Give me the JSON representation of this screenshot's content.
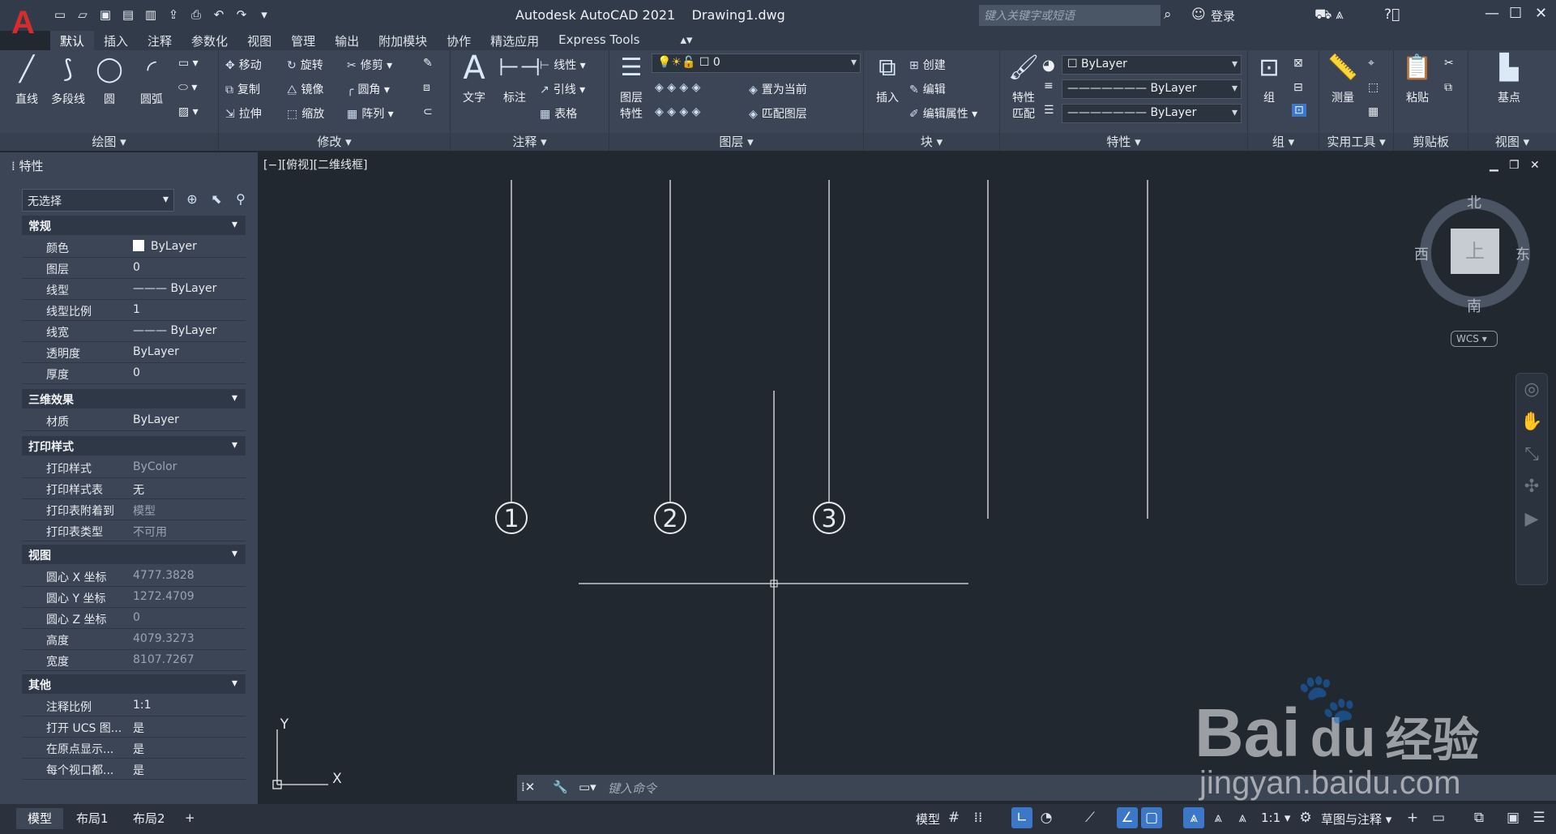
{
  "title": {
    "app": "Autodesk AutoCAD 2021",
    "file": "Drawing1.dwg"
  },
  "logo": "A",
  "search": {
    "placeholder": "键入关键字或短语"
  },
  "login": "登录",
  "tabs": [
    "默认",
    "插入",
    "注释",
    "参数化",
    "视图",
    "管理",
    "输出",
    "附加模块",
    "协作",
    "精选应用",
    "Express Tools"
  ],
  "ribbon": {
    "draw": {
      "title": "绘图",
      "line": "直线",
      "polyline": "多段线",
      "circle": "圆",
      "arc": "圆弧"
    },
    "modify": {
      "title": "修改",
      "move": "移动",
      "rotate": "旋转",
      "trim": "修剪",
      "copy": "复制",
      "mirror": "镜像",
      "fillet": "圆角",
      "stretch": "拉伸",
      "scale": "缩放",
      "array": "阵列"
    },
    "annotation": {
      "title": "注释",
      "text": "文字",
      "dimension": "标注",
      "linear": "线性",
      "leader": "引线",
      "table": "表格"
    },
    "layers": {
      "title": "图层",
      "props": "图层\n特性",
      "layer": "0",
      "set_current": "置为当前",
      "match_layer": "匹配图层"
    },
    "block": {
      "title": "块",
      "insert": "插入",
      "create": "创建",
      "edit": "编辑",
      "edit_attr": "编辑属性"
    },
    "properties": {
      "title": "特性",
      "match": "特性\n匹配",
      "color": "ByLayer",
      "linetype": "ByLayer",
      "lineweight": "ByLayer"
    },
    "groups": {
      "title": "组",
      "group": "组"
    },
    "utilities": {
      "title": "实用工具",
      "measure": "测量"
    },
    "clipboard": {
      "title": "剪贴板",
      "paste": "粘贴"
    },
    "view": {
      "title": "视图",
      "base": "基点"
    }
  },
  "props_panel": {
    "header": "特性",
    "selection": "无选择",
    "sections": [
      {
        "name": "常规",
        "rows": [
          [
            "颜色",
            "ByLayer"
          ],
          [
            "图层",
            "0"
          ],
          [
            "线型",
            "ByLayer"
          ],
          [
            "线型比例",
            "1"
          ],
          [
            "线宽",
            "ByLayer"
          ],
          [
            "透明度",
            "ByLayer"
          ],
          [
            "厚度",
            "0"
          ]
        ]
      },
      {
        "name": "三维效果",
        "rows": [
          [
            "材质",
            "ByLayer"
          ]
        ]
      },
      {
        "name": "打印样式",
        "rows": [
          [
            "打印样式",
            "ByColor"
          ],
          [
            "打印样式表",
            "无"
          ],
          [
            "打印表附着到",
            "模型"
          ],
          [
            "打印表类型",
            "不可用"
          ]
        ]
      },
      {
        "name": "视图",
        "rows": [
          [
            "圆心 X 坐标",
            "4777.3828"
          ],
          [
            "圆心 Y 坐标",
            "1272.4709"
          ],
          [
            "圆心 Z 坐标",
            "0"
          ],
          [
            "高度",
            "4079.3273"
          ],
          [
            "宽度",
            "8107.7267"
          ]
        ]
      },
      {
        "name": "其他",
        "rows": [
          [
            "注释比例",
            "1:1"
          ],
          [
            "打开 UCS 图...",
            "是"
          ],
          [
            "在原点显示...",
            "是"
          ],
          [
            "每个视口都...",
            "是"
          ]
        ]
      }
    ]
  },
  "viewport": {
    "label": "[−][俯视][二维线框]",
    "markers": [
      "1",
      "2",
      "3"
    ],
    "compass": {
      "north": "北",
      "south": "南",
      "east": "东",
      "west": "西",
      "top": "上"
    },
    "wcs": "WCS",
    "ucs_x": "X",
    "ucs_y": "Y"
  },
  "command": {
    "placeholder": "键入命令"
  },
  "layout_tabs": [
    "模型",
    "布局1",
    "布局2"
  ],
  "status": {
    "model": "模型",
    "scale": "1:1",
    "workspace": "草图与注释"
  },
  "watermark": {
    "brand": "Bai",
    "brand2": "du",
    "suffix": "经验",
    "site": "jingyan.baidu.com"
  },
  "colors": {
    "accent": "#3d77c7",
    "logo": "#d62c2c"
  }
}
